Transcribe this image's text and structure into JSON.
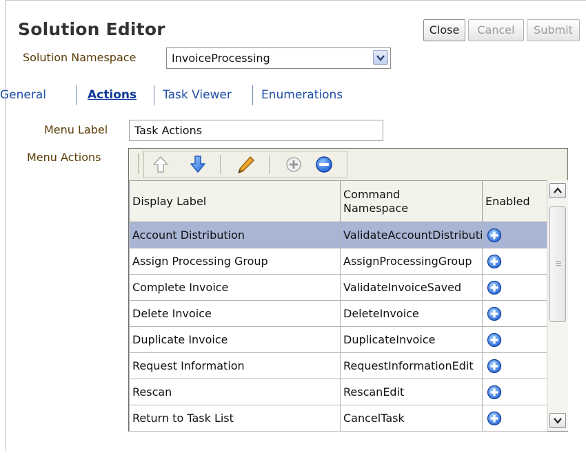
{
  "editor": {
    "title": "Solution Editor",
    "buttons": {
      "close": "Close",
      "cancel": "Cancel",
      "submit": "Submit"
    }
  },
  "namespace": {
    "label": "Solution Namespace",
    "value": "InvoiceProcessing"
  },
  "tabs": [
    {
      "label": "General",
      "active": false
    },
    {
      "label": "Actions",
      "active": true
    },
    {
      "label": "Task Viewer",
      "active": false
    },
    {
      "label": "Enumerations",
      "active": false
    }
  ],
  "menu_label": {
    "label": "Menu Label",
    "value": "Task Actions"
  },
  "menu_actions": {
    "label": "Menu Actions",
    "toolbar_icons": [
      "move-up-icon",
      "move-down-icon",
      "edit-pencil-icon",
      "add-icon",
      "remove-icon"
    ],
    "columns": {
      "display_label": "Display Label",
      "command_line1": "Command",
      "command_line2": "Namespace",
      "enabled": "Enabled"
    },
    "rows": [
      {
        "display_label": "Account Distribution",
        "command": "ValidateAccountDistribution",
        "selected": true
      },
      {
        "display_label": "Assign Processing Group",
        "command": "AssignProcessingGroup",
        "selected": false
      },
      {
        "display_label": "Complete Invoice",
        "command": "ValidateInvoiceSaved",
        "selected": false
      },
      {
        "display_label": "Delete Invoice",
        "command": "DeleteInvoice",
        "selected": false
      },
      {
        "display_label": "Duplicate Invoice",
        "command": "DuplicateInvoice",
        "selected": false
      },
      {
        "display_label": "Request Information",
        "command": "RequestInformationEdit",
        "selected": false
      },
      {
        "display_label": "Rescan",
        "command": "RescanEdit",
        "selected": false
      },
      {
        "display_label": "Return to Task List",
        "command": "CancelTask",
        "selected": false
      }
    ]
  },
  "colors": {
    "selected_row": "#a8b5d4",
    "link": "#1f4ea6",
    "label": "#5a3c05",
    "enabled_icon": "#2f6ad8"
  }
}
